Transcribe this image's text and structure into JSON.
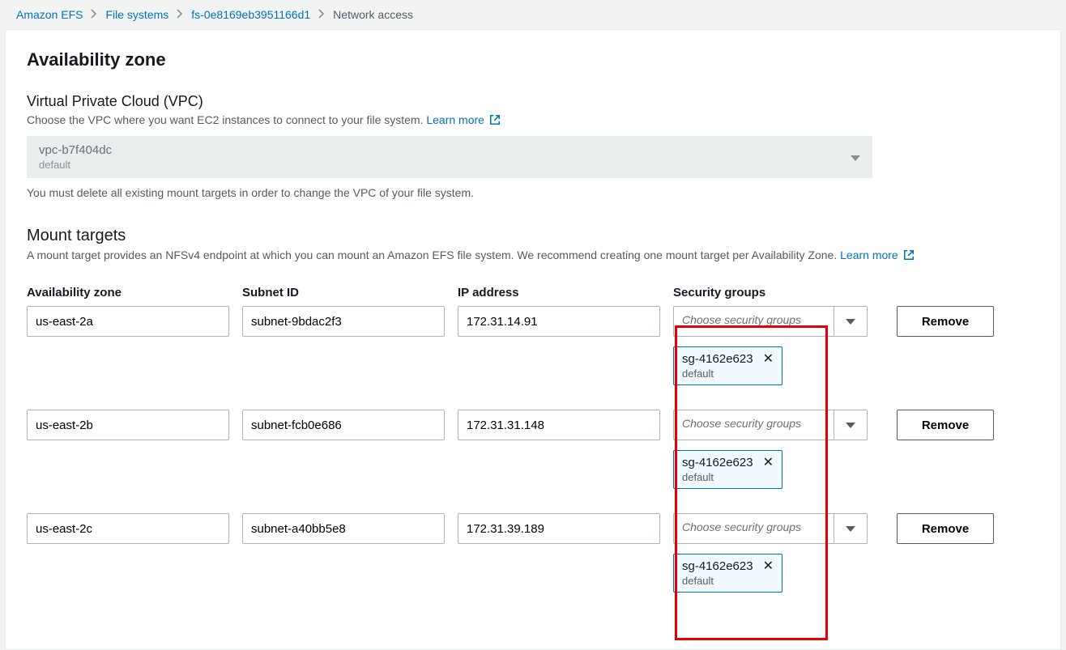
{
  "breadcrumb": {
    "root": "Amazon EFS",
    "fs_list": "File systems",
    "fs_id": "fs-0e8169eb3951166d1",
    "current": "Network access"
  },
  "page_title": "Availability zone",
  "vpc": {
    "label": "Virtual Private Cloud (VPC)",
    "desc": "Choose the VPC where you want EC2 instances to connect to your file system. ",
    "learn": "Learn more",
    "selected_id": "vpc-b7f404dc",
    "selected_name": "default",
    "hint": "You must delete all existing mount targets in order to change the VPC of your file system."
  },
  "mount": {
    "title": "Mount targets",
    "desc": "A mount target provides an NFSv4 endpoint at which you can mount an Amazon EFS file system. We recommend creating one mount target per Availability Zone. ",
    "learn": "Learn more"
  },
  "headers": {
    "az": "Availability zone",
    "subnet": "Subnet ID",
    "ip": "IP address",
    "sg": "Security groups"
  },
  "sg_placeholder": "Choose security groups",
  "remove_label": "Remove",
  "rows": [
    {
      "az": "us-east-2a",
      "subnet": "subnet-9bdac2f3",
      "ip": "172.31.14.91",
      "sg_id": "sg-4162e623",
      "sg_name": "default"
    },
    {
      "az": "us-east-2b",
      "subnet": "subnet-fcb0e686",
      "ip": "172.31.31.148",
      "sg_id": "sg-4162e623",
      "sg_name": "default"
    },
    {
      "az": "us-east-2c",
      "subnet": "subnet-a40bb5e8",
      "ip": "172.31.39.189",
      "sg_id": "sg-4162e623",
      "sg_name": "default"
    }
  ]
}
